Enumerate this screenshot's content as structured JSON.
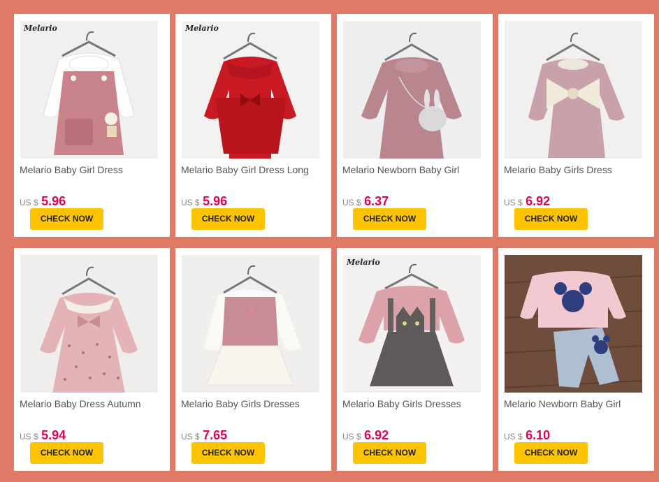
{
  "colors": {
    "page_background": "#df7a66",
    "card_background": "#ffffff",
    "price": "#e5004f",
    "button": "#ffc400"
  },
  "products": [
    {
      "brand": "Melario",
      "title": "Melario Baby Girl Dress",
      "currency": "US $",
      "price": "5.96",
      "button": "CHECK NOW",
      "image": "pink-pinafore-dress-with-giraffe"
    },
    {
      "brand": "Melario",
      "title": "Melario Baby Girl Dress Long",
      "currency": "US $",
      "price": "5.96",
      "button": "CHECK NOW",
      "image": "red-collar-dress-with-bow"
    },
    {
      "brand": "",
      "title": "Melario Newborn Baby Girl",
      "currency": "US $",
      "price": "6.37",
      "button": "CHECK NOW",
      "image": "mauve-dress-with-bunny-bag"
    },
    {
      "brand": "",
      "title": "Melario Baby Girls Dress",
      "currency": "US $",
      "price": "6.92",
      "button": "CHECK NOW",
      "image": "lilac-dress-with-big-bow"
    },
    {
      "brand": "",
      "title": "Melario Baby Dress Autumn",
      "currency": "US $",
      "price": "5.94",
      "button": "CHECK NOW",
      "image": "pink-heart-print-dress"
    },
    {
      "brand": "",
      "title": "Melario Baby Girls Dresses",
      "currency": "US $",
      "price": "7.65",
      "button": "CHECK NOW",
      "image": "knit-vest-lace-dress"
    },
    {
      "brand": "Melario",
      "title": "Melario Baby Girls Dresses",
      "currency": "US $",
      "price": "6.92",
      "button": "CHECK NOW",
      "image": "grey-cat-pinafore-dress"
    },
    {
      "brand": "",
      "title": "Melario Newborn Baby Girl",
      "currency": "US $",
      "price": "6.10",
      "button": "CHECK NOW",
      "image": "pink-mouse-sweatshirt-jeans-set"
    }
  ]
}
